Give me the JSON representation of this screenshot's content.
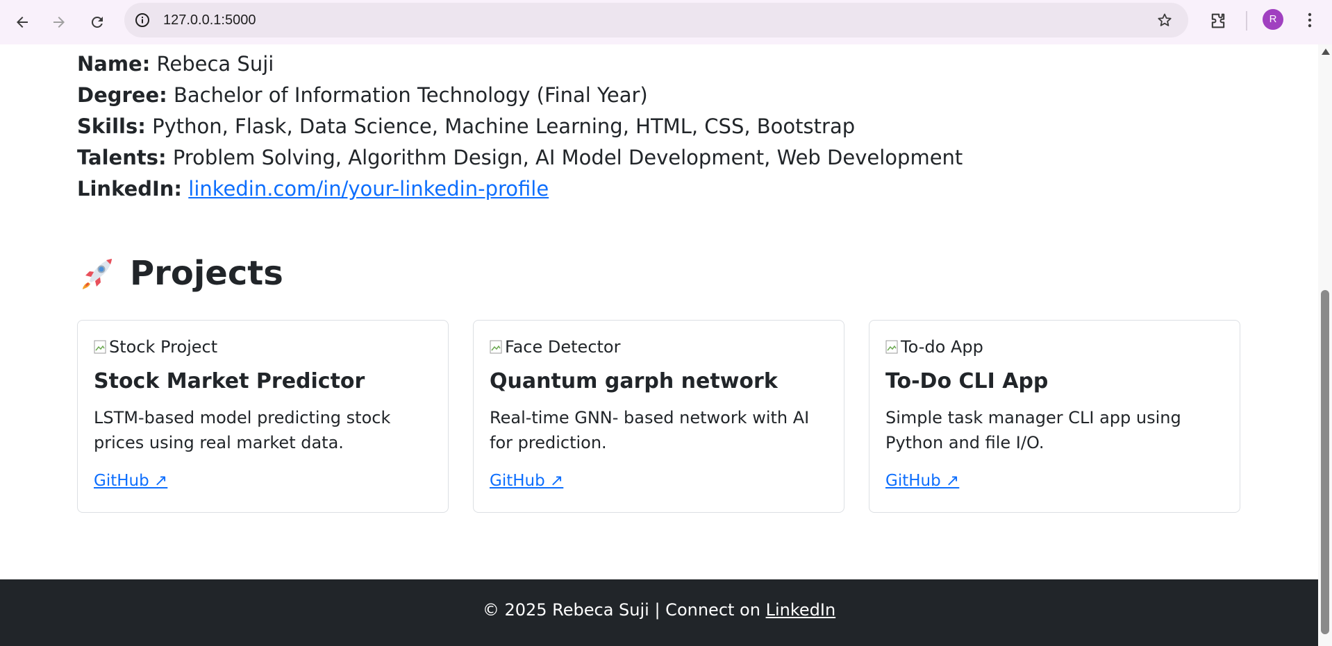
{
  "browser": {
    "url": "127.0.0.1:5000",
    "avatar_initial": "R"
  },
  "about": {
    "name_label": "Name:",
    "name_value": "Rebeca Suji",
    "degree_label": "Degree:",
    "degree_value": "Bachelor of Information Technology (Final Year)",
    "skills_label": "Skills:",
    "skills_value": "Python, Flask, Data Science, Machine Learning, HTML, CSS, Bootstrap",
    "talents_label": "Talents:",
    "talents_value": "Problem Solving, Algorithm Design, AI Model Development, Web Development",
    "linkedin_label": "LinkedIn:",
    "linkedin_value": "linkedin.com/in/your-linkedin-profile"
  },
  "projects": {
    "heading": "Projects",
    "icon": "rocket-icon",
    "items": [
      {
        "image_alt": "Stock Project",
        "title": "Stock Market Predictor",
        "description": "LSTM-based model predicting stock prices using real market data.",
        "link": "GitHub ↗"
      },
      {
        "image_alt": "Face Detector",
        "title": "Quantum garph network",
        "description": "Real-time GNN- based network with AI for prediction.",
        "link": "GitHub ↗"
      },
      {
        "image_alt": "To-do App",
        "title": "To-Do CLI App",
        "description": "Simple task manager CLI app using Python and file I/O.",
        "link": "GitHub ↗"
      }
    ]
  },
  "footer": {
    "text": "© 2025 Rebeca Suji | Connect on ",
    "link": "LinkedIn"
  },
  "colors": {
    "link": "#0d6efd",
    "footer_bg": "#212529",
    "chrome_bg": "#f9f1fb",
    "avatar": "#a040c0"
  }
}
